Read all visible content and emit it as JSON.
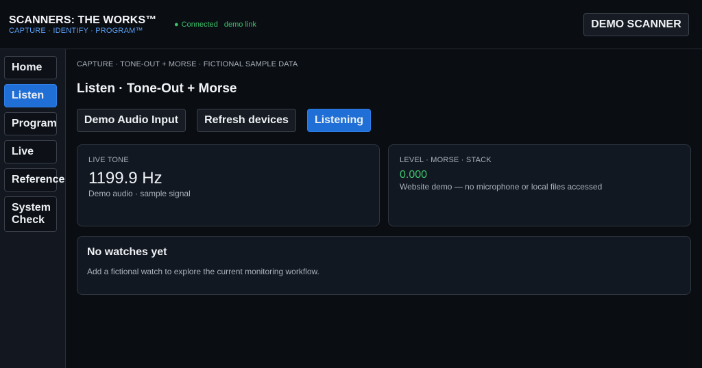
{
  "header": {
    "title": "SCANNERS: THE WORKS™",
    "subtitle": "CAPTURE · IDENTIFY · PROGRAM™",
    "status_dot": "●",
    "status": "Connected",
    "status_link": "demo link",
    "device_button": "DEMO SCANNER"
  },
  "sidebar": {
    "items": [
      {
        "label": "Home"
      },
      {
        "label": "Listen"
      },
      {
        "label": "Program"
      },
      {
        "label": "Live"
      },
      {
        "label": "Reference"
      },
      {
        "label": "System Check"
      }
    ]
  },
  "main": {
    "breadcrumb": "CAPTURE · TONE-OUT + MORSE · FICTIONAL SAMPLE DATA",
    "title": "Listen · Tone-Out + Morse",
    "toolbar": {
      "audio_input": "Demo Audio Input",
      "refresh": "Refresh devices",
      "listening": "Listening"
    },
    "cards": {
      "tone": {
        "label": "LIVE TONE",
        "value": "1199.9 Hz",
        "sub": "Demo audio · sample signal"
      },
      "level": {
        "label": "LEVEL · MORSE · STACK",
        "value": "0.000",
        "sub": "Website demo — no microphone or local files accessed"
      }
    },
    "watches": {
      "title": "No watches yet",
      "desc": "Add a fictional watch to explore the current monitoring workflow."
    }
  },
  "colors": {
    "accent": "#1f6fd6",
    "status_green": "#3ec46d",
    "subtitle_blue": "#5aa0f5",
    "background": "#0a0d12"
  }
}
